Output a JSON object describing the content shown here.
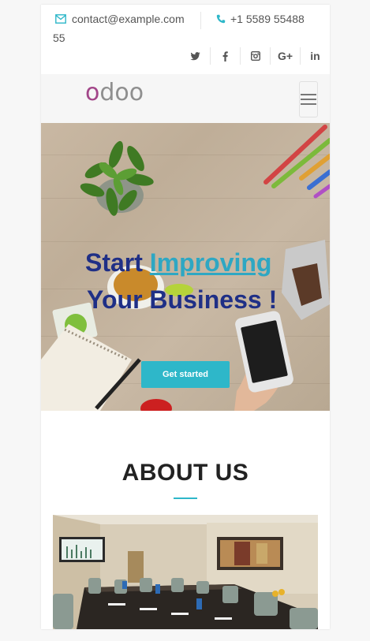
{
  "topbar": {
    "email": "contact@example.com",
    "phone_part1": "+1 5589 55488",
    "phone_part2": "55",
    "socials": [
      {
        "icon": "twitter-icon",
        "label": ""
      },
      {
        "icon": "facebook-icon",
        "label": ""
      },
      {
        "icon": "instagram-icon",
        "label": ""
      },
      {
        "icon": "google-plus-icon",
        "label": "G+"
      },
      {
        "icon": "linkedin-icon",
        "label": "in"
      }
    ]
  },
  "navbar": {
    "logo_first": "o",
    "logo_rest": "doo"
  },
  "hero": {
    "title_word1": "Start",
    "title_accent": "Improving",
    "title_line2": "Your Business !",
    "cta_label": "Get started"
  },
  "about": {
    "title": "ABOUT US"
  },
  "colors": {
    "accent": "#2eb7c9",
    "title_blue": "#1f2f86",
    "logo_purple": "#a24689"
  }
}
